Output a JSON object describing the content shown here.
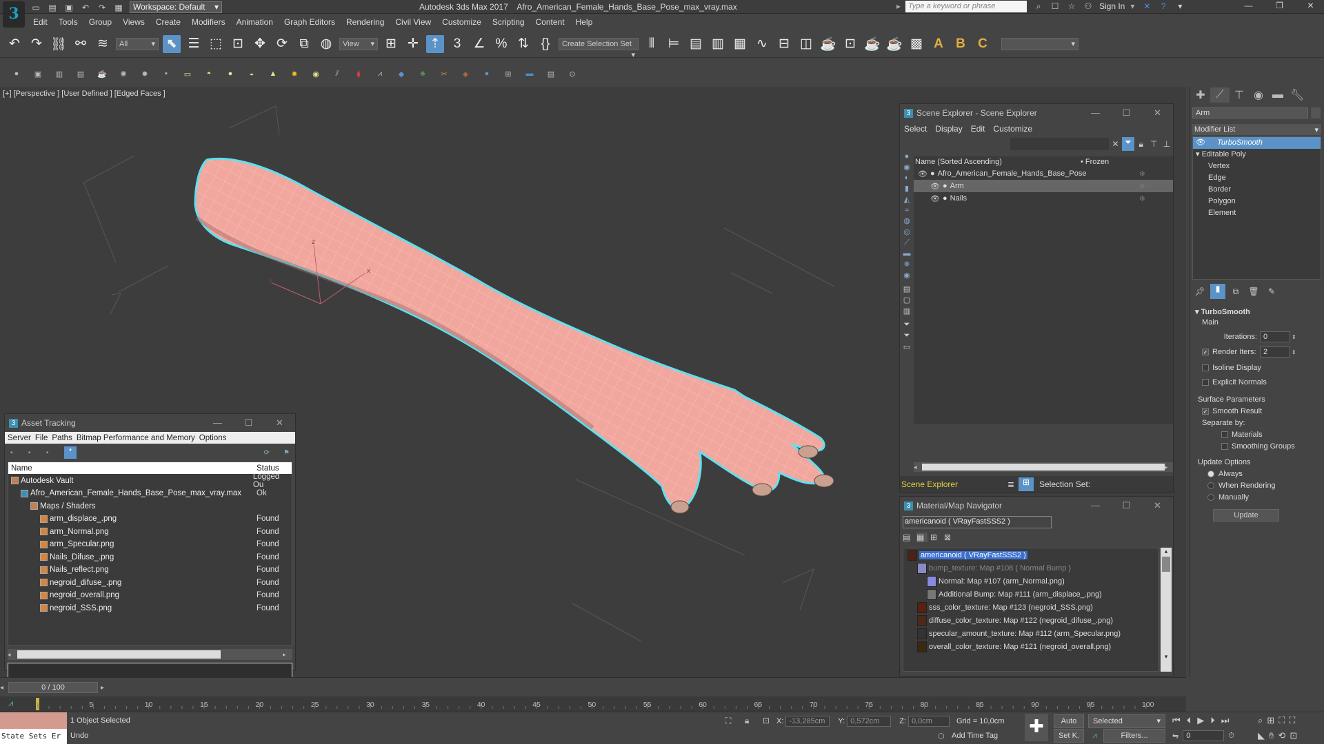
{
  "app": {
    "title": "Autodesk 3ds Max 2017    Afro_American_Female_Hands_Base_Pose_max_vray.max",
    "logo": "3",
    "workspace": "Workspace: Default",
    "search_placeholder": "Type a keyword or phrase",
    "sign_in": "Sign In"
  },
  "menu": [
    "Edit",
    "Tools",
    "Group",
    "Views",
    "Create",
    "Modifiers",
    "Animation",
    "Graph Editors",
    "Rendering",
    "Civil View",
    "Customize",
    "Scripting",
    "Content",
    "Help"
  ],
  "toolbar": {
    "filter": "All",
    "view": "View",
    "create_selection_set": "Create Selection Set",
    "abc": [
      "A",
      "B",
      "C"
    ]
  },
  "viewport": {
    "label": "[+] [Perspective ] [User Defined ] [Edged Faces ]",
    "gizmo": {
      "x": "x",
      "y": "y",
      "z": "z"
    }
  },
  "asset_tracking": {
    "title": "Asset Tracking",
    "menu": [
      "Server",
      "File",
      "Paths",
      "Bitmap Performance and Memory",
      "Options"
    ],
    "columns": [
      "Name",
      "Status"
    ],
    "rows": [
      {
        "name": "Autodesk Vault",
        "status": "Logged Ou",
        "indent": 0,
        "icon": "vault-icon"
      },
      {
        "name": "Afro_American_Female_Hands_Base_Pose_max_vray.max",
        "status": "Ok",
        "indent": 1,
        "icon": "max-file-icon"
      },
      {
        "name": "Maps / Shaders",
        "status": "",
        "indent": 2,
        "icon": "folder-icon"
      },
      {
        "name": "arm_displace_.png",
        "status": "Found",
        "indent": 3,
        "icon": "image-icon"
      },
      {
        "name": "arm_Normal.png",
        "status": "Found",
        "indent": 3,
        "icon": "image-icon"
      },
      {
        "name": "arm_Specular.png",
        "status": "Found",
        "indent": 3,
        "icon": "image-icon"
      },
      {
        "name": "Nails_Difuse_.png",
        "status": "Found",
        "indent": 3,
        "icon": "image-icon"
      },
      {
        "name": "Nails_reflect.png",
        "status": "Found",
        "indent": 3,
        "icon": "image-icon"
      },
      {
        "name": "negroid_difuse_.png",
        "status": "Found",
        "indent": 3,
        "icon": "image-icon"
      },
      {
        "name": "negroid_overall.png",
        "status": "Found",
        "indent": 3,
        "icon": "image-icon"
      },
      {
        "name": "negroid_SSS.png",
        "status": "Found",
        "indent": 3,
        "icon": "image-icon"
      }
    ]
  },
  "scene_explorer": {
    "title": "Scene Explorer - Scene Explorer",
    "menu": [
      "Select",
      "Display",
      "Edit",
      "Customize"
    ],
    "col_name": "Name (Sorted Ascending)",
    "col_frozen": "• Frozen",
    "items": [
      {
        "name": "Afro_American_Female_Hands_Base_Pose",
        "indent": 0,
        "selected": false
      },
      {
        "name": "Arm",
        "indent": 1,
        "selected": true
      },
      {
        "name": "Nails",
        "indent": 1,
        "selected": false
      }
    ],
    "footer_dropdown": "Scene Explorer",
    "selection_set": "Selection Set:"
  },
  "material_nav": {
    "title": "Material/Map Navigator",
    "current": "americanoid  ( VRayFastSSS2 )",
    "items": [
      {
        "text": "americanoid  ( VRayFastSSS2 )",
        "indent": 0,
        "style": "selected",
        "swatch": "#4a2218"
      },
      {
        "text": "bump_texture: Map #108  ( Normal Bump )",
        "indent": 1,
        "style": "dim",
        "swatch": "#8a8ac8"
      },
      {
        "text": "Normal: Map #107 (arm_Normal.png)",
        "indent": 2,
        "style": "normal",
        "swatch": "#8a8ae0"
      },
      {
        "text": "Additional Bump: Map #111 (arm_displace_.png)",
        "indent": 2,
        "style": "normal",
        "swatch": "#777"
      },
      {
        "text": "sss_color_texture: Map #123 (negroid_SSS.png)",
        "indent": 1,
        "style": "normal",
        "swatch": "#5a2010"
      },
      {
        "text": "diffuse_color_texture: Map #122 (negroid_difuse_.png)",
        "indent": 1,
        "style": "normal",
        "swatch": "#4a2a1a"
      },
      {
        "text": "specular_amount_texture: Map #112 (arm_Specular.png)",
        "indent": 1,
        "style": "normal",
        "swatch": "#333"
      },
      {
        "text": "overall_color_texture: Map #121 (negroid_overall.png)",
        "indent": 1,
        "style": "normal",
        "swatch": "#3a2810"
      }
    ]
  },
  "command_panel": {
    "object_name": "Arm",
    "modifier_list": "Modifier List",
    "stack": [
      {
        "name": "TurboSmooth",
        "selected": true,
        "italic": true,
        "indent": 0
      },
      {
        "name": "Editable Poly",
        "selected": false,
        "italic": false,
        "indent": 0
      },
      {
        "name": "Vertex",
        "selected": false,
        "italic": false,
        "indent": 1
      },
      {
        "name": "Edge",
        "selected": false,
        "italic": false,
        "indent": 1
      },
      {
        "name": "Border",
        "selected": false,
        "italic": false,
        "indent": 1
      },
      {
        "name": "Polygon",
        "selected": false,
        "italic": false,
        "indent": 1
      },
      {
        "name": "Element",
        "selected": false,
        "italic": false,
        "indent": 1
      }
    ],
    "rollout_title": "TurboSmooth",
    "main": "Main",
    "iterations_label": "Iterations:",
    "iterations": "0",
    "render_iters_label": "Render Iters:",
    "render_iters": "2",
    "isoline": "Isoline Display",
    "explicit": "Explicit Normals",
    "surface_params": "Surface Parameters",
    "smooth_result": "Smooth Result",
    "separate_by": "Separate by:",
    "materials": "Materials",
    "smoothing_groups": "Smoothing Groups",
    "update_options": "Update Options",
    "always": "Always",
    "when_rendering": "When Rendering",
    "manually": "Manually",
    "update": "Update"
  },
  "timeline": {
    "frame": "0 / 100",
    "ticks": [
      "5",
      "10",
      "15",
      "20",
      "25",
      "30",
      "35",
      "40",
      "45",
      "50",
      "55",
      "60",
      "65",
      "70",
      "75",
      "80",
      "85",
      "90",
      "95",
      "100"
    ]
  },
  "status": {
    "selected": "1 Object Selected",
    "undo": "Undo",
    "state_sets": "State Sets Er",
    "x_label": "X:",
    "x": "-13,285cm",
    "y_label": "Y:",
    "y": "0,572cm",
    "z_label": "Z:",
    "z": "0,0cm",
    "grid": "Grid = 10,0cm",
    "add_time_tag": "Add Time Tag",
    "auto": "Auto",
    "set_k": "Set K.",
    "selected_dd": "Selected",
    "filters": "Filters...",
    "frame_field": "0"
  }
}
